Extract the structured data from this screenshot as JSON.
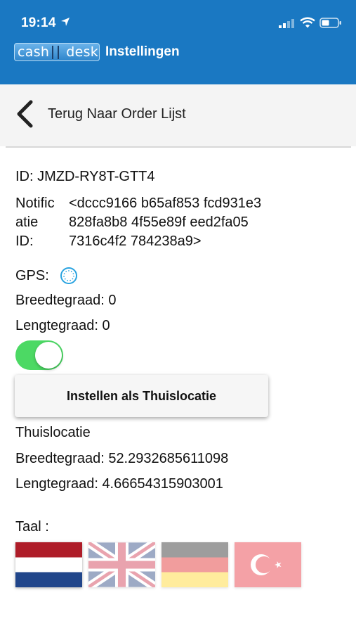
{
  "status_bar": {
    "time": "19:14"
  },
  "header": {
    "title": "Instellingen",
    "logo_left": "cash",
    "logo_right": "desk"
  },
  "nav": {
    "back_label": "Terug Naar  Order Lijst"
  },
  "device": {
    "id_text": "ID:  JMZD-RY8T-GTT4",
    "notification_label_lines": [
      "Notific",
      "atie",
      "ID:"
    ],
    "notification_value_lines": [
      "<dccc9166 b65af853 fcd931e3",
      "828fa8b8 4f55e89f eed2fa05",
      "7316c4f2 784238a9>"
    ]
  },
  "gps": {
    "label": "GPS:",
    "latitude_text": "Breedtegraad:  0",
    "longitude_text": "Lengtegraad:  0",
    "toggle_on": true
  },
  "home": {
    "button_label": "Instellen als Thuislocatie",
    "title": "Thuislocatie",
    "latitude_text": "Breedtegraad:  52.2932685611098",
    "longitude_text": "Lengtegraad:  4.66654315903001"
  },
  "language": {
    "label": "Taal :",
    "flags": [
      {
        "name": "nl",
        "selected": true
      },
      {
        "name": "en",
        "selected": false
      },
      {
        "name": "de",
        "selected": false
      },
      {
        "name": "tr",
        "selected": false
      }
    ]
  },
  "colors": {
    "header_bg": "#1a78c2",
    "toggle_on": "#4cd964",
    "accent": "#29a3e0"
  }
}
